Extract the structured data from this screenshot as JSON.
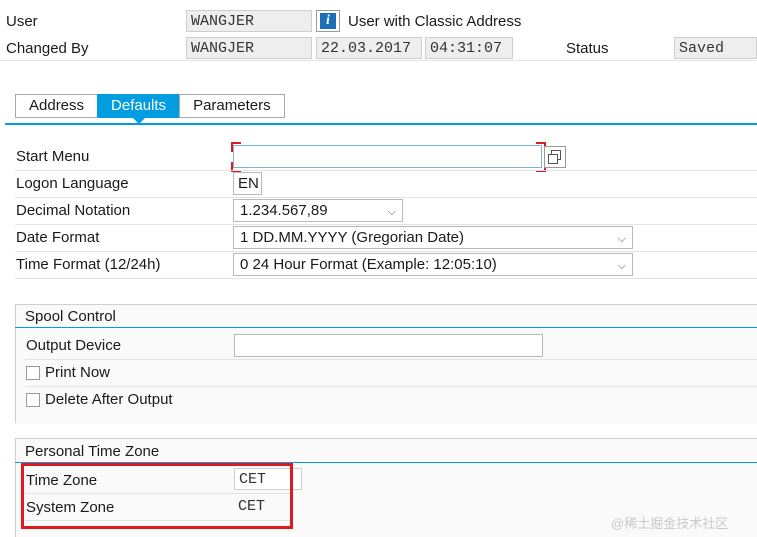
{
  "header": {
    "user_label": "User",
    "user_value": "WANGJER",
    "user_desc": "User with Classic Address",
    "changed_by_label": "Changed By",
    "changed_by_value": "WANGJER",
    "date": "22.03.2017",
    "time": "04:31:07",
    "status_label": "Status",
    "status_value": "Saved"
  },
  "tabs": [
    {
      "label": "Address",
      "active": false
    },
    {
      "label": "Defaults",
      "active": true
    },
    {
      "label": "Parameters",
      "active": false
    }
  ],
  "defaults": {
    "start_menu_label": "Start Menu",
    "start_menu_value": "",
    "logon_language_label": "Logon Language",
    "logon_language_value": "EN",
    "decimal_notation_label": "Decimal Notation",
    "decimal_notation_value": "1.234.567,89",
    "date_format_label": "Date Format",
    "date_format_value": "1 DD.MM.YYYY (Gregorian Date)",
    "time_format_label": "Time Format (12/24h)",
    "time_format_value": "0 24 Hour Format (Example: 12:05:10)"
  },
  "spool": {
    "title": "Spool Control",
    "output_device_label": "Output Device",
    "output_device_value": "",
    "print_now_label": "Print Now",
    "delete_after_output_label": "Delete After Output"
  },
  "timezone": {
    "title": "Personal Time Zone",
    "time_zone_label": "Time Zone",
    "time_zone_value": "CET",
    "system_zone_label": "System Zone",
    "system_zone_value": "CET"
  },
  "watermark": "@稀土掘金技术社区",
  "colors": {
    "accent": "#009de0",
    "highlight": "#e0191f",
    "info_icon": "#1d6fb8"
  }
}
